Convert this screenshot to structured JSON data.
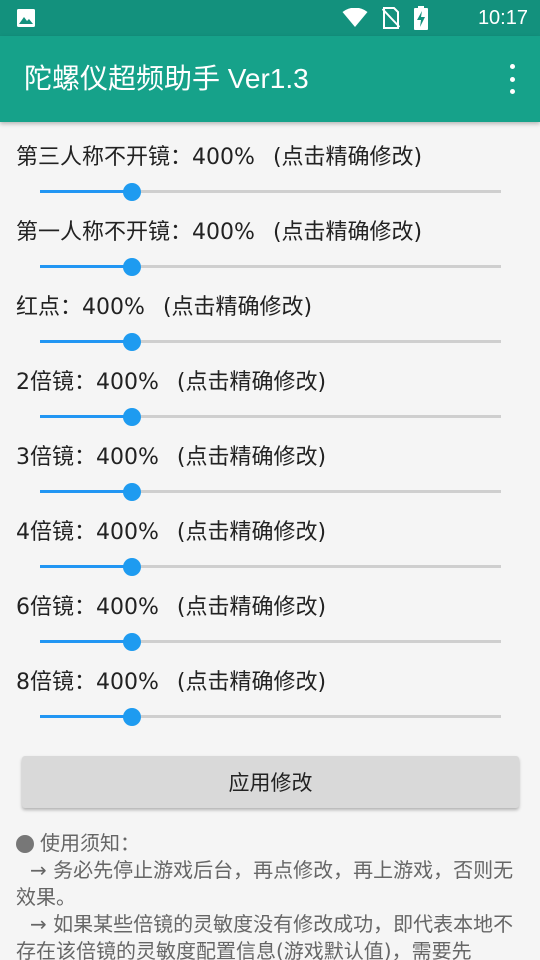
{
  "status_bar": {
    "time": "10:17",
    "icons": [
      "image-icon",
      "wifi-icon",
      "no-sim-icon",
      "battery-charging-icon"
    ]
  },
  "app_bar": {
    "title": "陀螺仪超频助手 Ver1.3",
    "menu_icon": "more-vert-icon"
  },
  "settings": [
    {
      "label": "第三人称不开镜",
      "value": "400%",
      "hint": "(点击精确修改)",
      "level": 0.2
    },
    {
      "label": "第一人称不开镜",
      "value": "400%",
      "hint": "(点击精确修改)",
      "level": 0.2
    },
    {
      "label": "红点",
      "value": "400%",
      "hint": "(点击精确修改)",
      "level": 0.2
    },
    {
      "label": "2倍镜",
      "value": "400%",
      "hint": "(点击精确修改)",
      "level": 0.2
    },
    {
      "label": "3倍镜",
      "value": "400%",
      "hint": "(点击精确修改)",
      "level": 0.2
    },
    {
      "label": "4倍镜",
      "value": "400%",
      "hint": "(点击精确修改)",
      "level": 0.2
    },
    {
      "label": "6倍镜",
      "value": "400%",
      "hint": "(点击精确修改)",
      "level": 0.2
    },
    {
      "label": "8倍镜",
      "value": "400%",
      "hint": "(点击精确修改)",
      "level": 0.2
    }
  ],
  "separator": "：",
  "apply_button": "应用修改",
  "notice": {
    "title": "使用须知：",
    "lines": [
      "→ 务必先停止游戏后台，再点修改，再上游戏，否则无效果。",
      "→ 如果某些倍镜的灵敏度没有修改成功，即代表本地不存在该倍镜的灵敏度配置信息(游戏默认值)，需要先"
    ]
  },
  "colors": {
    "status_bar": "#13917d",
    "app_bar": "#16a28a",
    "accent": "#2196f3",
    "track": "#cfcfcf",
    "background": "#f5f5f5",
    "button": "#d9d9d9"
  }
}
